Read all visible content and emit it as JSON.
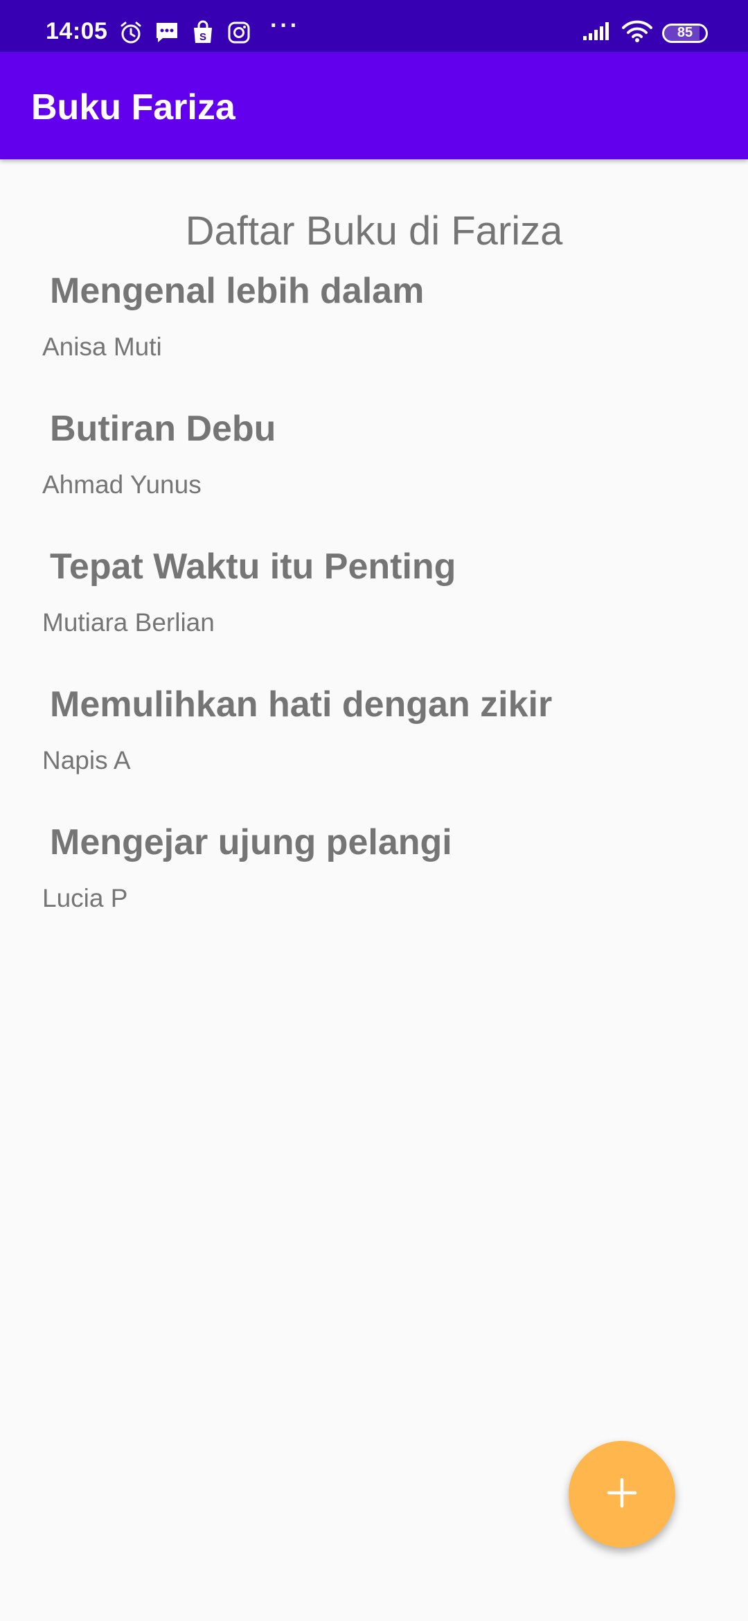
{
  "status_bar": {
    "time": "14:05",
    "dots": "···",
    "battery_level": "85",
    "battery_fraction": 0.85,
    "icons_left": [
      "alarm-icon",
      "message-icon",
      "shopping-bag-icon",
      "instagram-icon"
    ],
    "icons_right": [
      "signal-icon",
      "wifi-icon",
      "battery-icon"
    ]
  },
  "app_bar": {
    "title": "Buku Fariza",
    "color": "#6200ee"
  },
  "main": {
    "heading": "Daftar Buku di Fariza",
    "books": [
      {
        "title": "Mengenal lebih dalam",
        "author": "Anisa Muti"
      },
      {
        "title": "Butiran Debu",
        "author": "Ahmad Yunus"
      },
      {
        "title": "Tepat Waktu itu Penting",
        "author": "Mutiara Berlian"
      },
      {
        "title": "Memulihkan hati dengan zikir",
        "author": "Napis A"
      },
      {
        "title": "Mengejar ujung pelangi",
        "author": "Lucia P"
      }
    ]
  },
  "fab": {
    "icon": "plus-icon",
    "color": "#ffb74d"
  }
}
